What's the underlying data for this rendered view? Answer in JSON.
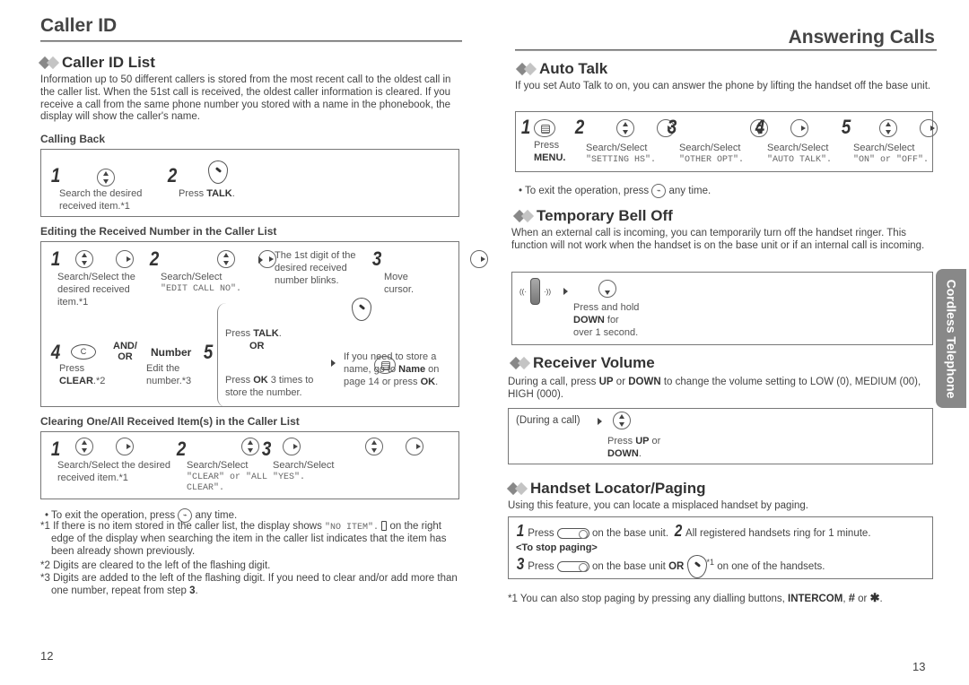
{
  "left_page": {
    "title": "Caller ID",
    "section": {
      "heading": "Caller ID List",
      "intro": "Information up to 50 different callers is stored from the most recent call to the oldest call in the caller list. When the 51st call is received, the oldest caller information is cleared. If you receive a call from the same phone number you stored with a name in the phonebook, the display will show the caller's name."
    },
    "calling_back": {
      "heading": "Calling Back",
      "steps": [
        {
          "num": "1",
          "text": "Search the desired received item.*1"
        },
        {
          "num": "2",
          "text_pre": "Press ",
          "text_bold": "TALK",
          "text_post": "."
        }
      ]
    },
    "editing": {
      "heading": "Editing the Received Number in the Caller List",
      "step1": {
        "num": "1",
        "text": "Search/Select the desired received item.*1"
      },
      "step2": {
        "num": "2",
        "text": "Search/Select",
        "mono": "\"EDIT CALL NO\"."
      },
      "step2_note": "The 1st digit of the desired received number blinks.",
      "step3": {
        "num": "3",
        "text": "Move cursor."
      },
      "step4": {
        "num": "4",
        "button": "C",
        "text_pre": "Press",
        "text_bold": "CLEAR",
        "text_post": ".*2"
      },
      "and_or": "AND/\nOR",
      "number": {
        "label": "Number",
        "text": "Edit the number.*3"
      },
      "step5": {
        "num": "5",
        "talk_pre": "Press ",
        "talk_bold": "TALK",
        "talk_post": ".",
        "or": "OR",
        "ok_pre": "Press ",
        "ok_bold": "OK",
        "ok_post": " 3 times to store the number."
      },
      "step5_note": {
        "pre": "If you need to store a name, go to ",
        "bold1": "Name",
        "mid": " on page 14 or press ",
        "bold2": "OK",
        "post": "."
      }
    },
    "clearing": {
      "heading": "Clearing One/All Received Item(s) in the Caller List",
      "steps": [
        {
          "num": "1",
          "text": "Search/Select the desired received item.*1",
          "mono": ""
        },
        {
          "num": "2",
          "text": "Search/Select",
          "mono": "\"CLEAR\" or \"ALL CLEAR\"."
        },
        {
          "num": "3",
          "text": "Search/Select",
          "mono": "\"YES\"."
        }
      ]
    },
    "notes": {
      "exit_pre": "To exit the operation, press",
      "exit_post": "any time.",
      "n1_pre": "*1 If there is no item stored in the caller list, the display shows ",
      "n1_mono": "\"NO ITEM\".",
      "n1_post": " on the right edge of the display when searching the item in the caller list indicates that the item has been already shown previously.",
      "n2": "*2 Digits are cleared to the left of the flashing digit.",
      "n3_pre": "*3 Digits are added to the left of the flashing digit. If you need to clear and/or add more than one number, repeat from step ",
      "n3_bold": "3",
      "n3_post": "."
    },
    "page_number": "12"
  },
  "right_page": {
    "title": "Answering Calls",
    "auto_talk": {
      "heading": "Auto Talk",
      "intro": "If you set Auto Talk to on, you can answer the phone by lifting the handset off the base unit.",
      "steps": [
        {
          "num": "1",
          "text": "Press",
          "bold": "MENU."
        },
        {
          "num": "2",
          "text": "Search/Select",
          "mono": "\"SETTING HS\"."
        },
        {
          "num": "3",
          "text": "Search/Select",
          "mono": "\"OTHER OPT\"."
        },
        {
          "num": "4",
          "text": "Search/Select",
          "mono": "\"AUTO TALK\"."
        },
        {
          "num": "5",
          "text": "Search/Select",
          "mono": "\"ON\" or \"OFF\"."
        }
      ],
      "exit_pre": "To exit the operation, press",
      "exit_post": "any time."
    },
    "bell_off": {
      "heading": "Temporary Bell Off",
      "intro": "When an external call is incoming, you can temporarily turn off the handset ringer. This function will not work when the handset is on the base unit or if an internal call is incoming.",
      "text_pre": "Press and hold",
      "text_bold": "DOWN",
      "text_mid": " for",
      "text_post": "over 1 second."
    },
    "receiver_volume": {
      "heading": "Receiver Volume",
      "intro_pre": "During a call, press ",
      "intro_b1": "UP",
      "intro_mid": " or ",
      "intro_b2": "DOWN",
      "intro_post": " to change the volume setting to LOW (0), MEDIUM (00), HIGH (000).",
      "context": "(During a call)",
      "text_pre": "Press ",
      "text_b1": "UP",
      "text_mid": " or",
      "text_b2": "DOWN",
      "text_post": "."
    },
    "locator": {
      "heading": "Handset Locator/Paging",
      "intro": "Using this feature, you can locate a misplaced handset by paging.",
      "step1_pre": "Press",
      "step1_post": "on the base unit.",
      "step2": "All registered handsets ring for 1 minute.",
      "stop_heading": "<To stop paging>",
      "step3_pre": "Press",
      "step3_mid": "on the base unit",
      "step3_or": "OR",
      "step3_sup": "*1",
      "step3_post": "on one of the handsets.",
      "footnote_pre": "*1 You can also stop paging by pressing any dialling buttons, ",
      "footnote_bold": "INTERCOM",
      "footnote_mid": ", ",
      "footnote_hash": "#",
      "footnote_or": " or ",
      "footnote_star": "✱",
      "footnote_post": "."
    },
    "side_tab": "Cordless Telephone",
    "page_number": "13"
  }
}
